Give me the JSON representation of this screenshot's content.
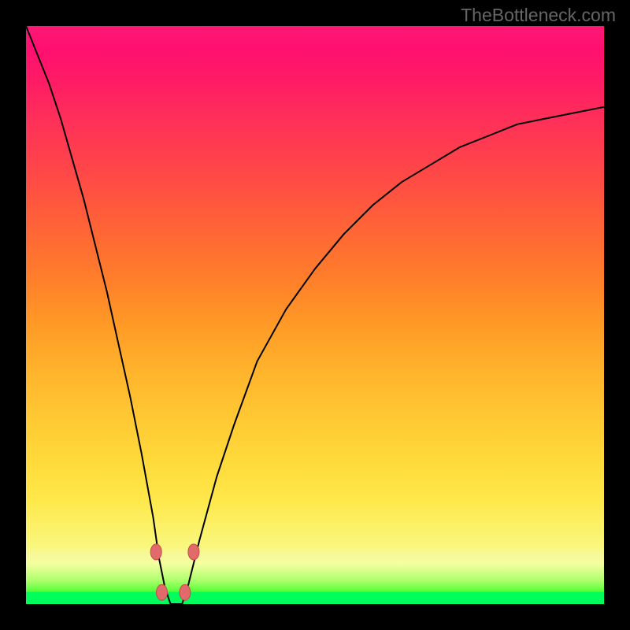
{
  "meta": {
    "source_label": "TheBottleneck.com"
  },
  "chart_data": {
    "type": "line",
    "title": "",
    "xlabel": "",
    "ylabel": "",
    "xlim": [
      0,
      100
    ],
    "ylim": [
      0,
      100
    ],
    "grid": false,
    "legend": false,
    "x": [
      0,
      2,
      4,
      6,
      8,
      10,
      12,
      14,
      16,
      18,
      20,
      22,
      23,
      24,
      25,
      26,
      27,
      28,
      30,
      33,
      36,
      40,
      45,
      50,
      55,
      60,
      65,
      70,
      75,
      80,
      85,
      90,
      95,
      100
    ],
    "series": [
      {
        "name": "bottleneck-curve",
        "values": [
          100,
          95,
          90,
          84,
          77,
          70,
          62,
          54,
          45,
          36,
          26,
          15,
          8,
          3,
          0,
          0,
          0,
          3,
          11,
          22,
          31,
          42,
          51,
          58,
          64,
          69,
          73,
          76,
          79,
          81,
          83,
          84,
          85,
          86
        ]
      }
    ],
    "markers": [
      {
        "x": 22.5,
        "y": 9
      },
      {
        "x": 29,
        "y": 9
      },
      {
        "x": 23.5,
        "y": 2
      },
      {
        "x": 27.5,
        "y": 2
      }
    ],
    "colors": {
      "curve": "#000000",
      "marker_fill": "#e36a6a",
      "marker_stroke": "#c24b4b",
      "gradient_top": "#ff1775",
      "gradient_bottom": "#00ff5a"
    }
  }
}
